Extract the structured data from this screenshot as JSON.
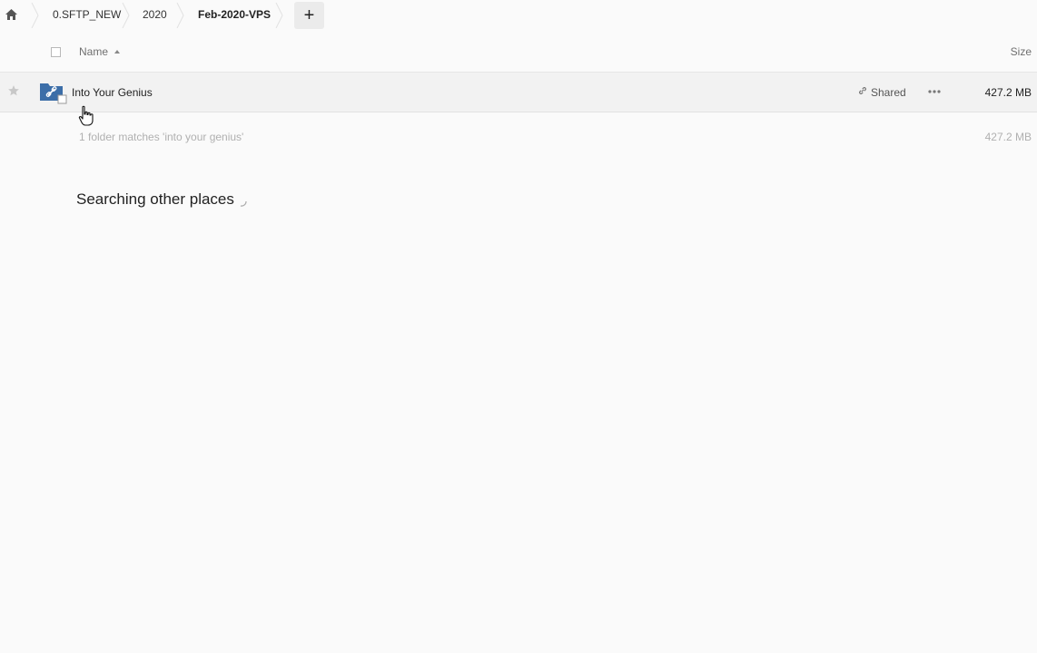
{
  "breadcrumb": {
    "items": [
      {
        "label": "0.SFTP_NEW"
      },
      {
        "label": "2020"
      },
      {
        "label": "Feb-2020-VPS"
      }
    ],
    "add_label": "+"
  },
  "columns": {
    "name": "Name",
    "size": "Size",
    "sort": "ascending"
  },
  "files": [
    {
      "name": "Into Your Genius",
      "type": "shared-folder",
      "shared_label": "Shared",
      "size": "427.2 MB",
      "icon": "shared-folder-icon"
    }
  ],
  "summary": {
    "text": "1 folder matches 'into your genius'",
    "size": "427.2 MB"
  },
  "search_status": "Searching other places",
  "colors": {
    "folder_blue": "#3c6ea8",
    "background": "#fafafa",
    "muted_text": "#b0b0b0"
  }
}
